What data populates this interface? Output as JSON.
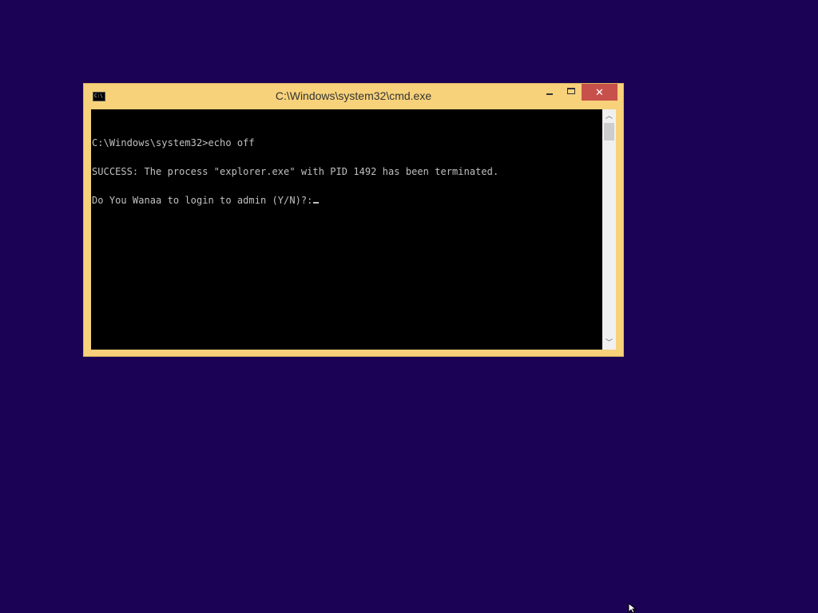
{
  "desktop": {
    "background_color": "#1c0254"
  },
  "window": {
    "title": "C:\\Windows\\system32\\cmd.exe",
    "icon_label": "C:\\",
    "frame_color": "#f7d27a",
    "close_color": "#c7504a",
    "buttons": {
      "minimize_icon": "minimize-icon",
      "maximize_icon": "maximize-icon",
      "close_icon": "close-icon",
      "close_glyph": "✕"
    }
  },
  "console": {
    "background_color": "#000000",
    "text_color": "#c0c0c0",
    "lines": [
      "C:\\Windows\\system32>echo off",
      "SUCCESS: The process \"explorer.exe\" with PID 1492 has been terminated.",
      "Do You Wanaa to login to admin (Y/N)?:"
    ]
  },
  "scrollbar": {
    "up_glyph": "︿",
    "down_glyph": "﹀"
  }
}
